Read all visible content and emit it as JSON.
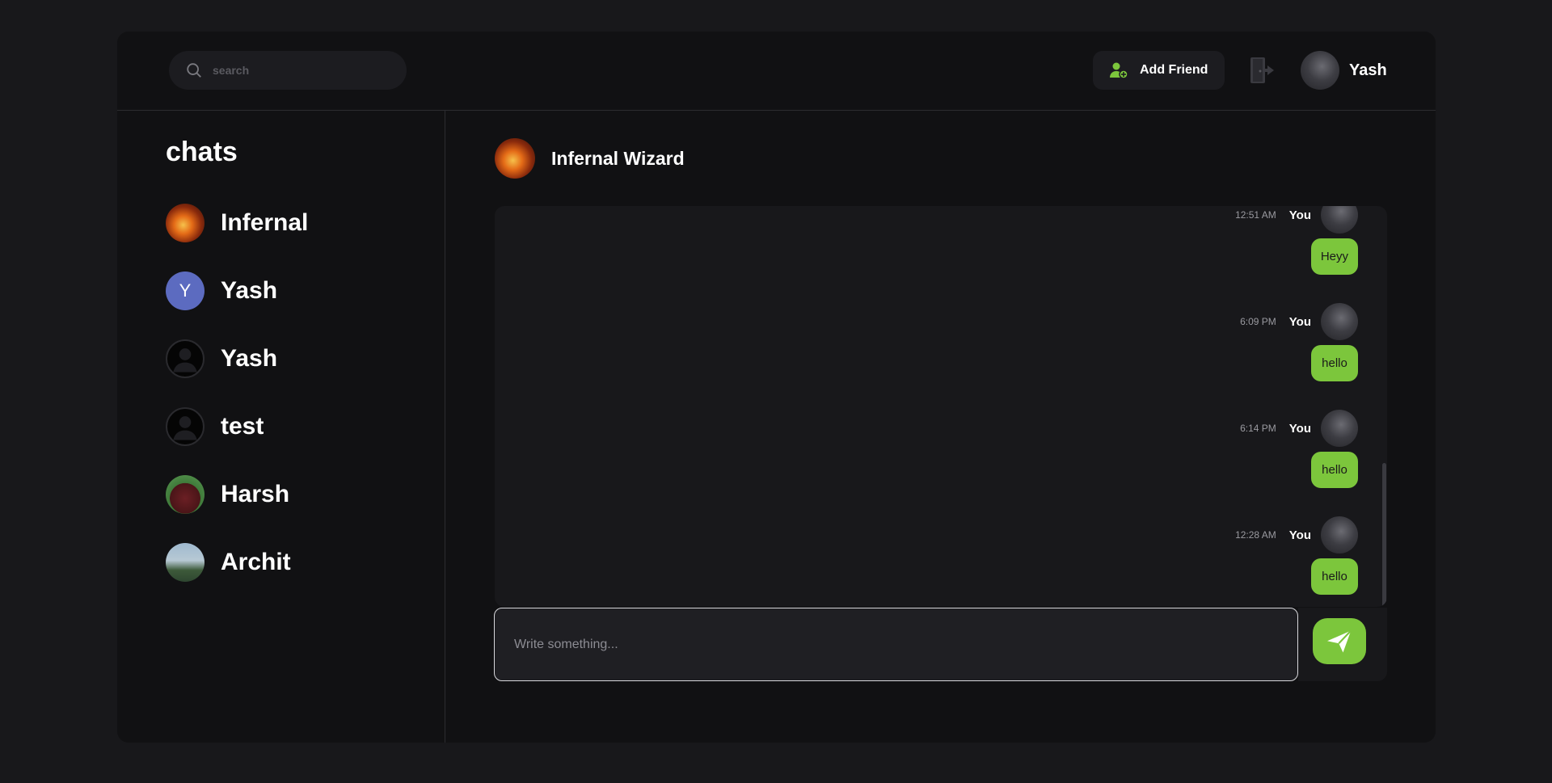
{
  "header": {
    "search_placeholder": "search",
    "add_friend_label": "Add Friend",
    "user_name": "Yash"
  },
  "sidebar": {
    "title": "chats",
    "items": [
      {
        "name": "Infernal",
        "avatar": "fire-avatar"
      },
      {
        "name": "Yash",
        "avatar": "letter-avatar",
        "initial": "Y"
      },
      {
        "name": "Yash",
        "avatar": "default-person-avatar"
      },
      {
        "name": "test",
        "avatar": "default-person-avatar"
      },
      {
        "name": "Harsh",
        "avatar": "bear-avatar"
      },
      {
        "name": "Archit",
        "avatar": "photo-avatar"
      }
    ]
  },
  "conversation": {
    "title": "Infernal Wizard",
    "messages": [
      {
        "time": "12:51 AM",
        "sender": "You",
        "text": "Heyy"
      },
      {
        "time": "6:09 PM",
        "sender": "You",
        "text": "hello"
      },
      {
        "time": "6:14 PM",
        "sender": "You",
        "text": "hello"
      },
      {
        "time": "12:28 AM",
        "sender": "You",
        "text": "hello"
      }
    ],
    "composer_placeholder": "Write something..."
  },
  "colors": {
    "accent": "#7cc63c",
    "background": "#18181b",
    "panel": "#111113",
    "letter_avatar": "#5c6bc0"
  },
  "icons": {
    "search": "search-icon",
    "add_friend": "add-user-icon",
    "logout": "logout-icon",
    "send": "send-icon"
  }
}
